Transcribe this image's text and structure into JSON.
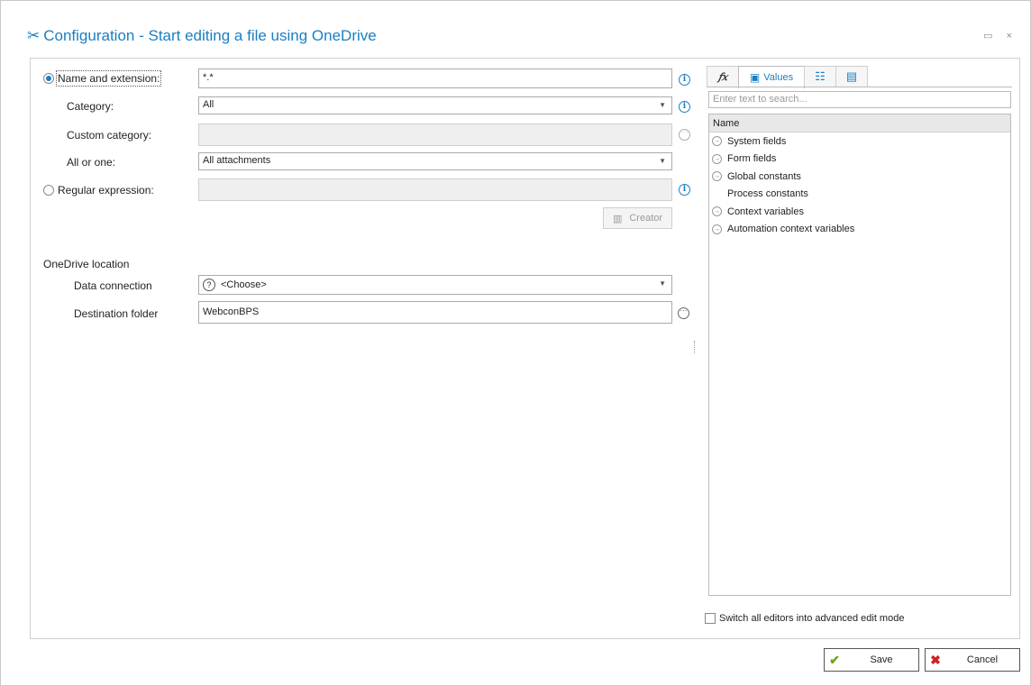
{
  "window": {
    "title": "Configuration - Start editing a file using OneDrive",
    "controls": "▭ ×"
  },
  "form": {
    "name_ext_label": "Name and extension:",
    "name_ext_value": "*.*",
    "category_label": "Category:",
    "category_value": "All",
    "custom_category_label": "Custom category:",
    "custom_category_value": "",
    "all_or_one_label": "All or one:",
    "all_or_one_value": "All attachments",
    "regex_label": "Regular expression:",
    "regex_value": "",
    "creator_label": "Creator",
    "onedrive_section": "OneDrive location",
    "data_connection_label": "Data connection",
    "data_connection_value": "<Choose>",
    "destination_label": "Destination folder",
    "destination_value": "WebconBPS"
  },
  "panel": {
    "tabs": [
      {
        "label": "",
        "icon": "function-icon",
        "glyph": "𝑓𝑥"
      },
      {
        "label": "Values",
        "icon": "values-icon",
        "glyph": "▣"
      },
      {
        "label": "",
        "icon": "list-icon",
        "glyph": "☷"
      },
      {
        "label": "",
        "icon": "document-icon",
        "glyph": "▤"
      }
    ],
    "search_placeholder": "Enter text to search...",
    "column_header": "Name",
    "items": [
      {
        "label": "System fields",
        "expandable": true
      },
      {
        "label": "Form fields",
        "expandable": true
      },
      {
        "label": "Global constants",
        "expandable": true
      },
      {
        "label": "Process constants",
        "expandable": false
      },
      {
        "label": "Context variables",
        "expandable": true
      },
      {
        "label": "Automation context variables",
        "expandable": true
      }
    ],
    "advanced_mode_label": "Switch all editors into advanced edit mode"
  },
  "footer": {
    "save_label": "Save",
    "cancel_label": "Cancel"
  },
  "colors": {
    "accent": "#1a7fc3",
    "save_icon": "#6aa51e",
    "cancel_icon": "#d02020"
  }
}
